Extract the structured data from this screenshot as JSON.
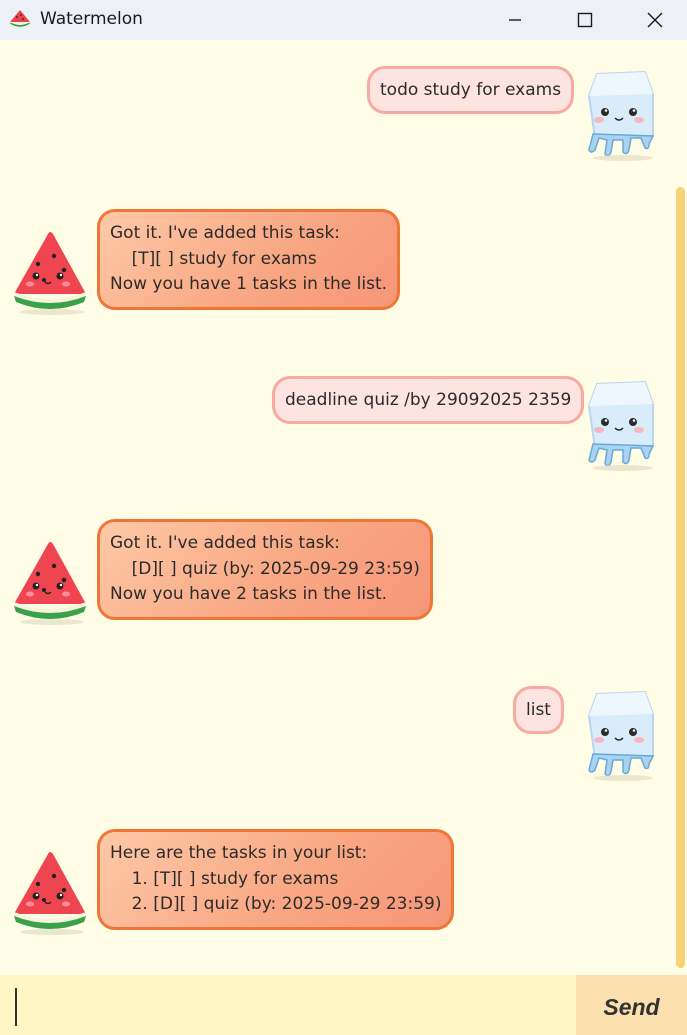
{
  "window": {
    "title": "Watermelon",
    "minimize_icon": "minimize-icon",
    "maximize_icon": "maximize-icon",
    "close_icon": "close-icon"
  },
  "messages": [
    {
      "sender": "user",
      "text": "todo study for exams",
      "avatar": "ice-cube-avatar"
    },
    {
      "sender": "bot",
      "text": "Got it. I've added this task:\n    [T][ ] study for exams\nNow you have 1 tasks in the list.",
      "avatar": "watermelon-avatar"
    },
    {
      "sender": "user",
      "text": "deadline quiz /by 29092025 2359",
      "avatar": "ice-cube-avatar"
    },
    {
      "sender": "bot",
      "text": "Got it. I've added this task:\n    [D][ ] quiz (by: 2025-09-29 23:59)\nNow you have 2 tasks in the list.",
      "avatar": "watermelon-avatar"
    },
    {
      "sender": "user",
      "text": "list",
      "avatar": "ice-cube-avatar"
    },
    {
      "sender": "bot",
      "text": "Here are the tasks in your list:\n    1. [T][ ] study for exams\n    2. [D][ ] quiz (by: 2025-09-29 23:59)",
      "avatar": "watermelon-avatar"
    }
  ],
  "input": {
    "value": "",
    "placeholder": ""
  },
  "send_label": "Send",
  "colors": {
    "background": "#fffde6",
    "user_bubble": "#fde4e1",
    "user_border": "#f6aaa3",
    "bot_bubble": "#f9a884",
    "bot_border": "#ee7637",
    "scrollbar": "#f8d277",
    "input_bg": "#fff8c6",
    "send_bg": "#fde0b0"
  }
}
